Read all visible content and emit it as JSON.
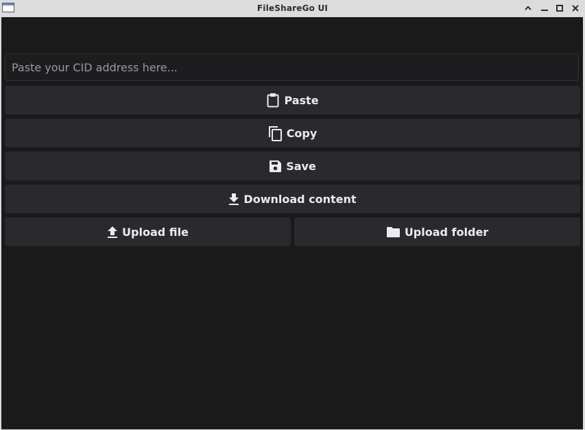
{
  "window": {
    "title": "FileShareGo UI",
    "controls": [
      "maximize-icon",
      "minimize-icon",
      "restore-icon",
      "close-icon"
    ]
  },
  "cid_input": {
    "placeholder": "Paste your CID address here...",
    "value": ""
  },
  "buttons": {
    "paste": {
      "label": "Paste",
      "icon": "clipboard-icon"
    },
    "copy": {
      "label": "Copy",
      "icon": "copy-icon"
    },
    "save": {
      "label": "Save",
      "icon": "save-icon"
    },
    "download": {
      "label": "Download content",
      "icon": "download-icon"
    },
    "upload_file": {
      "label": "Upload file",
      "icon": "upload-icon"
    },
    "upload_folder": {
      "label": "Upload folder",
      "icon": "folder-icon"
    }
  },
  "colors": {
    "background": "#1a1a1b",
    "button": "#2a2a2e",
    "text": "#ececec"
  }
}
